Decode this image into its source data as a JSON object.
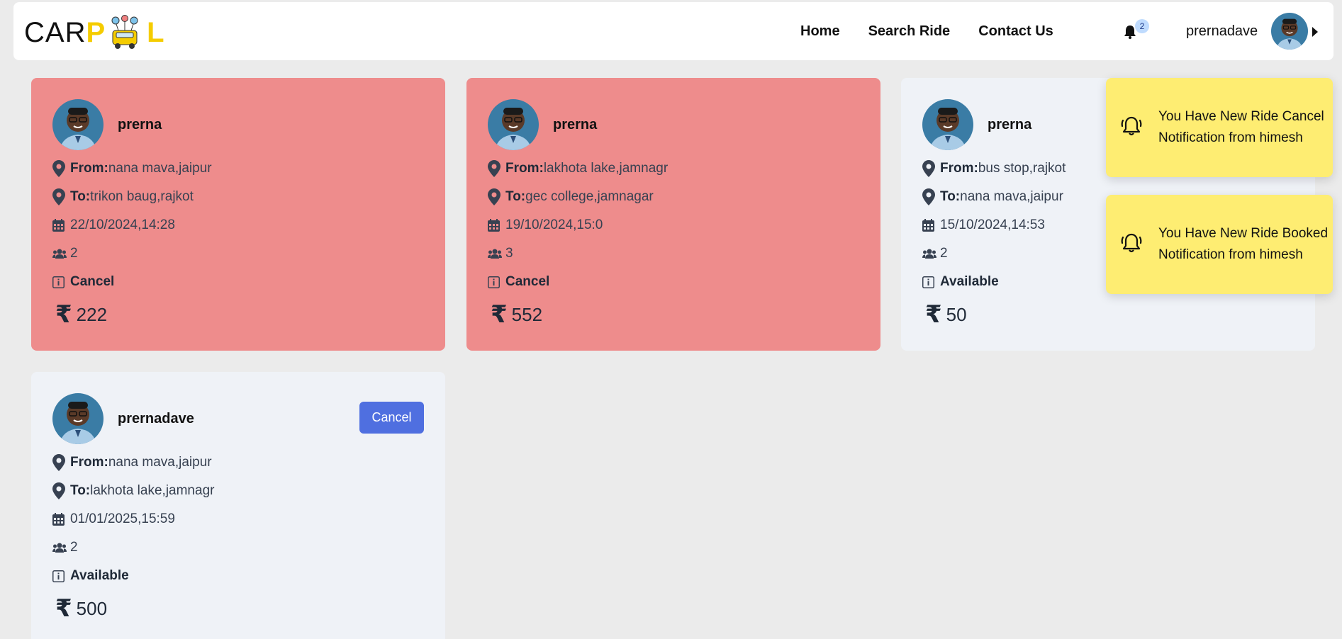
{
  "nav": {
    "logo_car": "CAR",
    "logo_p": "P",
    "logo_l": "L",
    "links": [
      "Home",
      "Search Ride",
      "Contact Us"
    ],
    "notification_count": "2",
    "username": "prernadave"
  },
  "rides": [
    {
      "name": "prerna",
      "from_label": "From:",
      "from": "nana mava,jaipur",
      "to_label": "To:",
      "to": "trikon baug,rajkot",
      "datetime": "22/10/2024,14:28",
      "seats": "2",
      "status": "Cancel",
      "price": "222"
    },
    {
      "name": "prerna",
      "from_label": "From:",
      "from": "lakhota lake,jamnagr",
      "to_label": "To:",
      "to": "gec college,jamnagar",
      "datetime": "19/10/2024,15:0",
      "seats": "3",
      "status": "Cancel",
      "price": "552"
    },
    {
      "name": "prerna",
      "from_label": "From:",
      "from": "bus stop,rajkot",
      "to_label": "To:",
      "to": "nana mava,jaipur",
      "datetime": "15/10/2024,14:53",
      "seats": "2",
      "status": "Available",
      "price": "50"
    },
    {
      "name": "prernadave",
      "from_label": "From:",
      "from": "nana mava,jaipur",
      "to_label": "To:",
      "to": "lakhota lake,jamnagr",
      "datetime": "01/01/2025,15:59",
      "seats": "2",
      "status": "Available",
      "price": "500",
      "action_label": "Cancel"
    }
  ],
  "notifications": [
    {
      "text": "You Have New Ride Cancel Notification from himesh"
    },
    {
      "text": "You Have New Ride Booked Notification from himesh"
    }
  ],
  "colors": {
    "cancel_card": "#ee8c8c",
    "available_card": "#eff2f7",
    "toast": "#feed72",
    "primary_button": "#4f6fe0",
    "logo_accent": "#f5cc00"
  }
}
